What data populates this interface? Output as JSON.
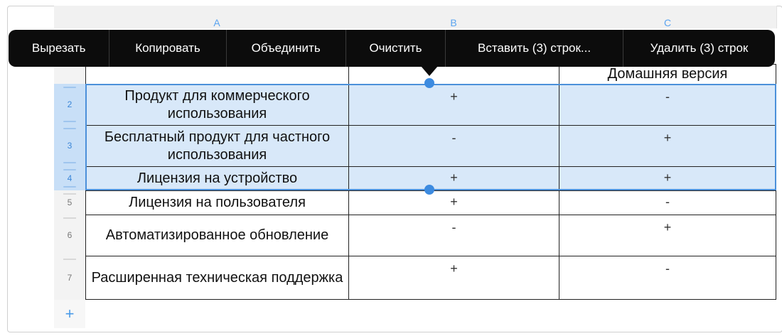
{
  "columns": [
    "A",
    "B",
    "C"
  ],
  "toolbar": {
    "items": [
      "Вырезать",
      "Копировать",
      "Объединить",
      "Очистить",
      "Вставить (3) строк...",
      "Удалить (3) строк"
    ]
  },
  "rows": [
    {
      "num": "",
      "a": "",
      "b": "",
      "c": "Домашняя версия"
    },
    {
      "num": "2",
      "a": "Продукт для коммерческого использования",
      "b": "+",
      "c": "-"
    },
    {
      "num": "3",
      "a": "Бесплатный продукт для частного использования",
      "b": "-",
      "c": "+"
    },
    {
      "num": "4",
      "a": "Лицензия на устройство",
      "b": "+",
      "c": "+"
    },
    {
      "num": "5",
      "a": "Лицензия на пользователя",
      "b": "+",
      "c": "-"
    },
    {
      "num": "6",
      "a": "Автоматизированное обновление",
      "b": "-",
      "c": "+"
    },
    {
      "num": "7",
      "a": "Расширенная техническая поддержка",
      "b": "+",
      "c": "-"
    }
  ],
  "add_row_icon": "plus-icon",
  "colors": {
    "selection": "#d8e8f9",
    "accent": "#4b90da",
    "toolbar": "#0c0c0c"
  }
}
